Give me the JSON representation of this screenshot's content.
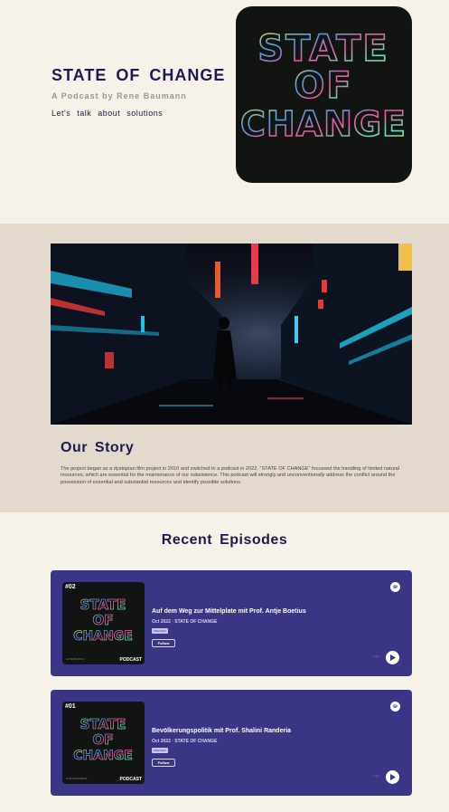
{
  "hero": {
    "title": "STATE OF CHANGE",
    "subtitle": "A Podcast by Rene Baumann",
    "tagline": "Let's talk about solutions",
    "cover_text": [
      "STATE",
      "OF",
      "CHANGE"
    ]
  },
  "story": {
    "heading": "Our Story",
    "body": "The project began as a dystopian film project in 2010 and switched to a podcast in 2022. \"STATE OF CHANGE\" focussed the handling of limited natural resources, which are essential for the maintenance of our subsistence. This podcast will strongly and unconventionally address the conflict around the possession of essential and substantial resources and identify possible solutions."
  },
  "episodes": {
    "heading": "Recent Episodes",
    "items": [
      {
        "number": "#02",
        "title": "Auf dem Weg zur Mittelplate mit Prof. Antje Boetius",
        "meta": "Oct 2022 · STATE OF CHANGE",
        "badge": "PREVIEW",
        "follow": "Follow",
        "art_label": "PODCAST",
        "art_caption": "ANTJE BOETIUS",
        "dots": "···"
      },
      {
        "number": "#01",
        "title": "Bevölkerungspolitik mit Prof. Shalini Randeria",
        "meta": "Oct 2022 · STATE OF CHANGE",
        "badge": "PREVIEW",
        "follow": "Follow",
        "art_label": "PODCAST",
        "art_caption": "SHALINI RANDERIA",
        "dots": "···"
      }
    ]
  },
  "colors": {
    "page_bg": "#f7f2e9",
    "story_bg": "#e3dacd",
    "navy_text": "#1c1a4e",
    "episode_card": "#3a3585"
  },
  "icons": [
    "spotify-icon",
    "play-icon"
  ]
}
